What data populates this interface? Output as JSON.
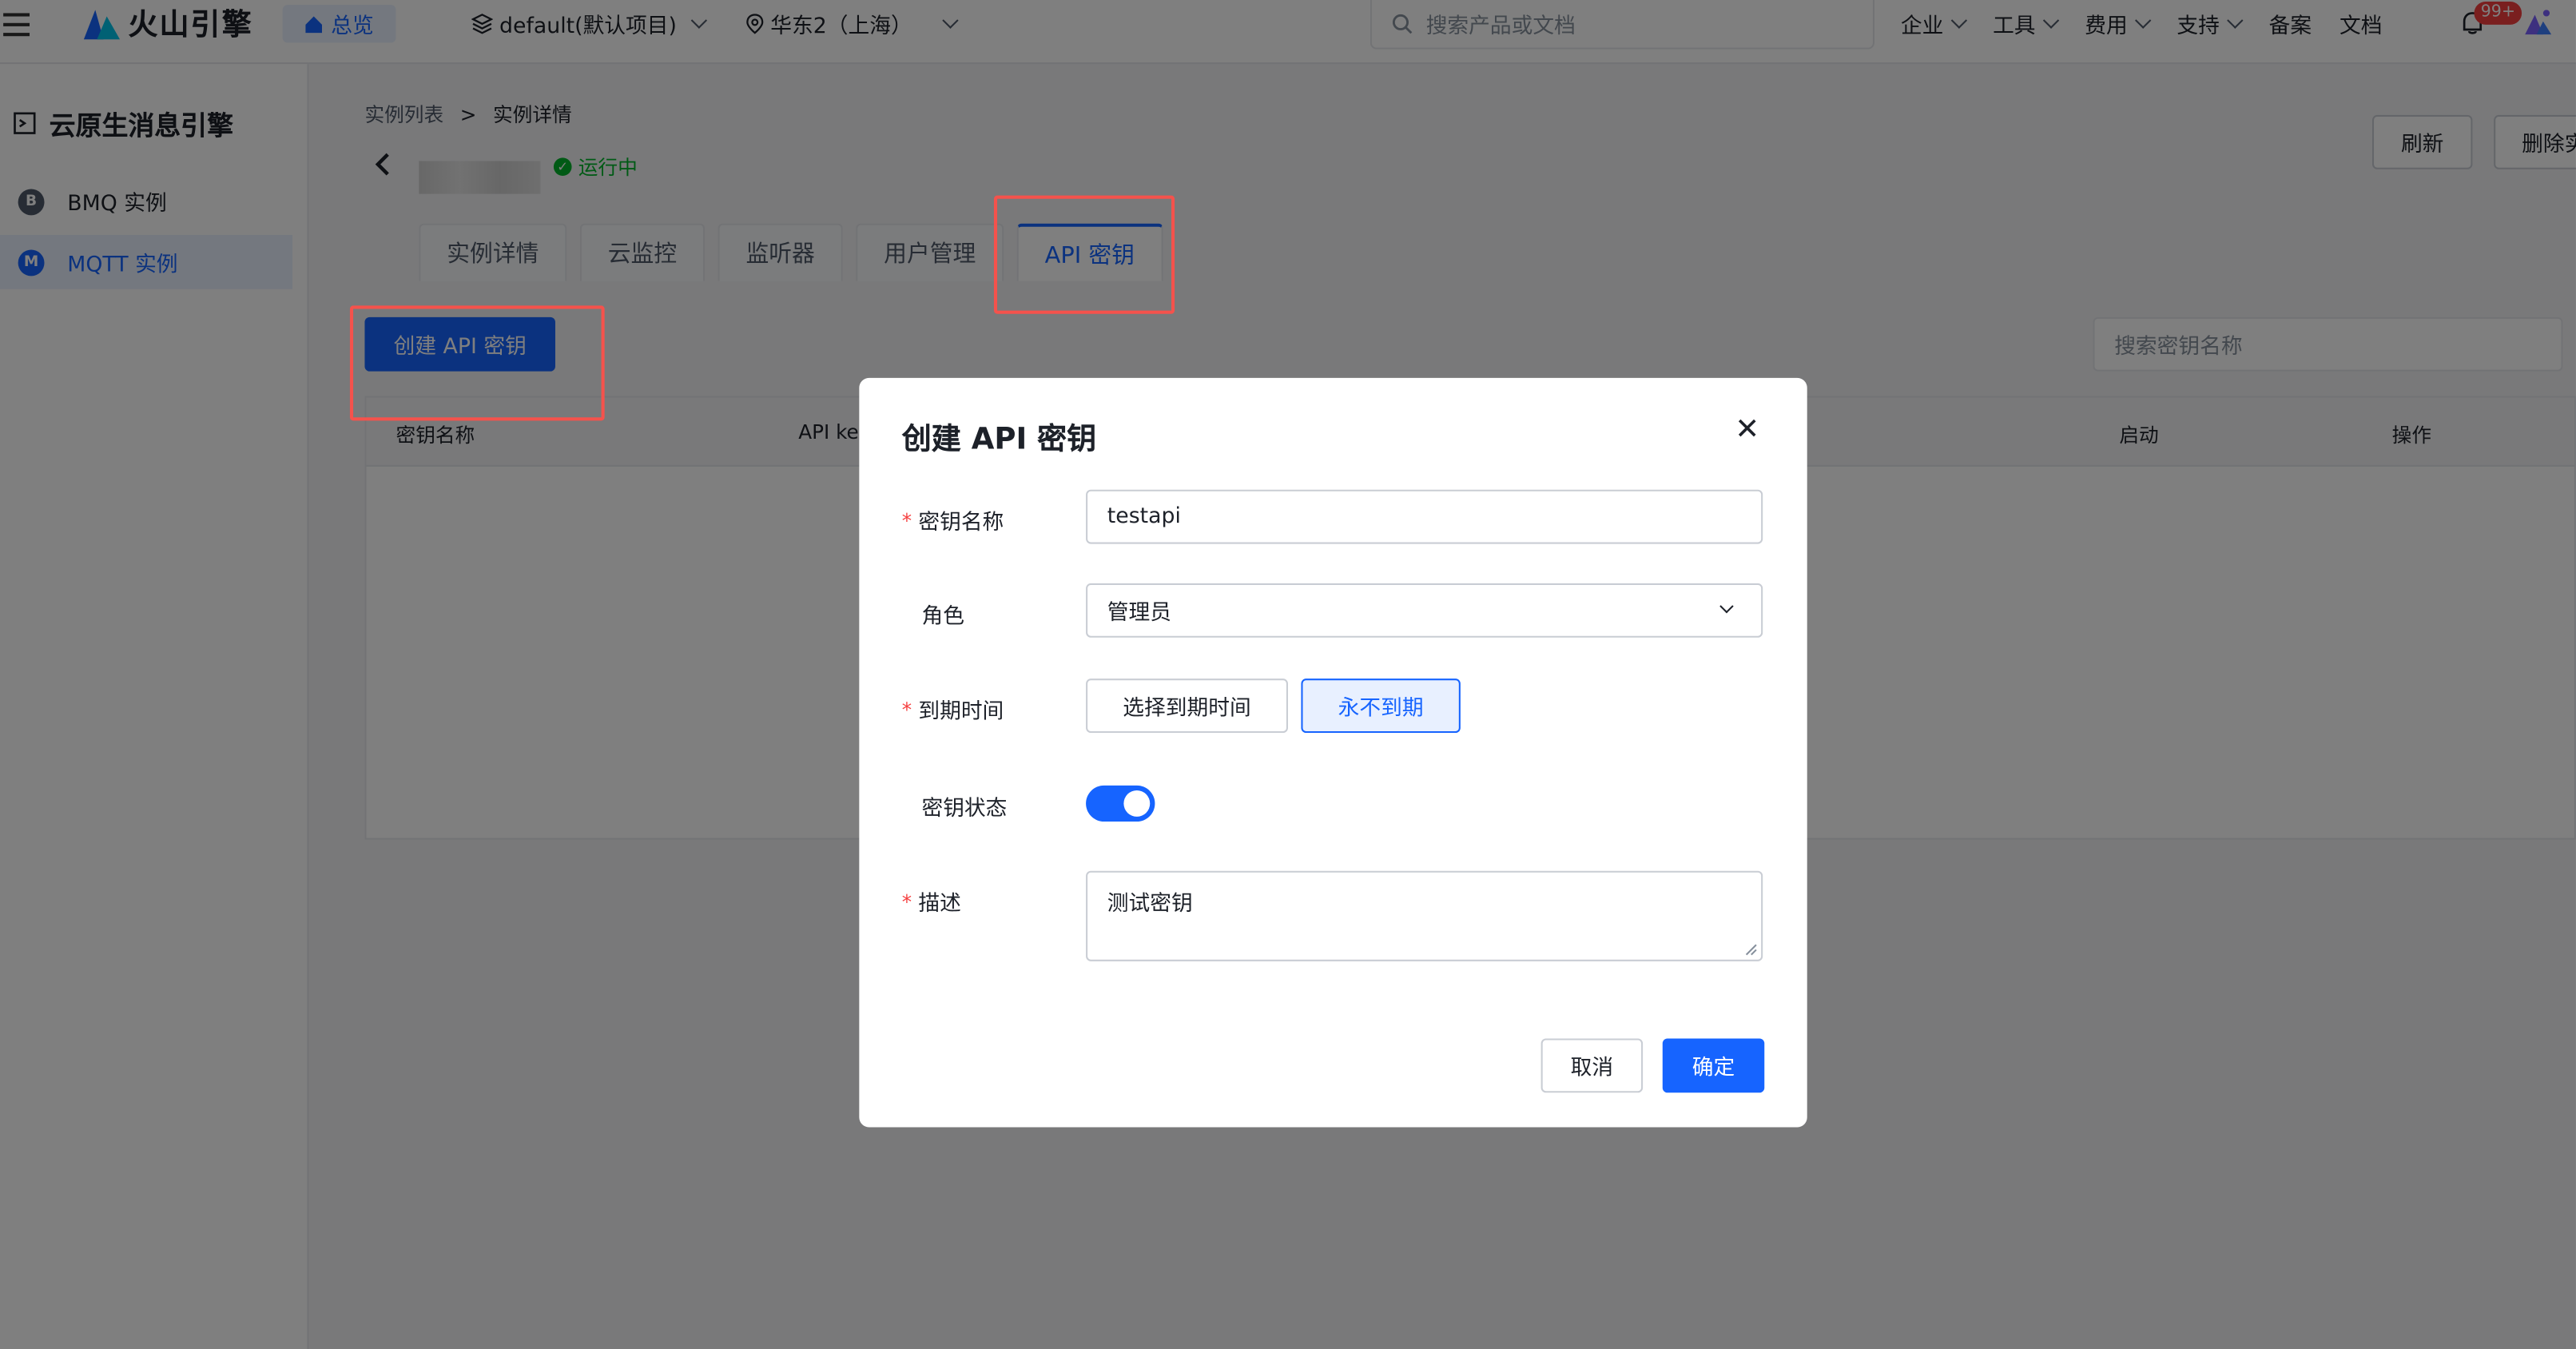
{
  "topbar": {
    "brand": "火山引擎",
    "home": "总览",
    "project": "default(默认项目)",
    "region": "华东2（上海）",
    "search_placeholder": "搜索产品或文档",
    "nav": [
      "企业",
      "工具",
      "费用",
      "支持",
      "备案",
      "文档"
    ],
    "notifications": "99+"
  },
  "sidebar": {
    "title": "云原生消息引擎",
    "items": [
      {
        "label": "BMQ 实例",
        "icon": "B"
      },
      {
        "label": "MQTT 实例",
        "icon": "M"
      }
    ]
  },
  "breadcrumb": {
    "parent": "实例列表",
    "sep": ">",
    "current": "实例详情"
  },
  "instance": {
    "status": "运行中"
  },
  "actions": {
    "refresh": "刷新",
    "delete": "删除实"
  },
  "tabs": [
    "实例详情",
    "云监控",
    "监听器",
    "用户管理",
    "API 密钥"
  ],
  "create_button": "创建 API 密钥",
  "key_search_placeholder": "搜索密钥名称",
  "table": {
    "headers": [
      "密钥名称",
      "API key",
      "启动",
      "操作"
    ]
  },
  "modal": {
    "title": "创建 API 密钥",
    "name_label": "密钥名称",
    "name_value": "testapi",
    "role_label": "角色",
    "role_value": "管理员",
    "expire_label": "到期时间",
    "expire_option_pick": "选择到期时间",
    "expire_option_never": "永不到期",
    "status_label": "密钥状态",
    "status_on": true,
    "desc_label": "描述",
    "desc_value": "测试密钥",
    "required_mark": "*",
    "cancel": "取消",
    "ok": "确定"
  },
  "colors": {
    "accent": "#1664ff",
    "highlight": "#f5524c",
    "success": "#00b42a"
  }
}
